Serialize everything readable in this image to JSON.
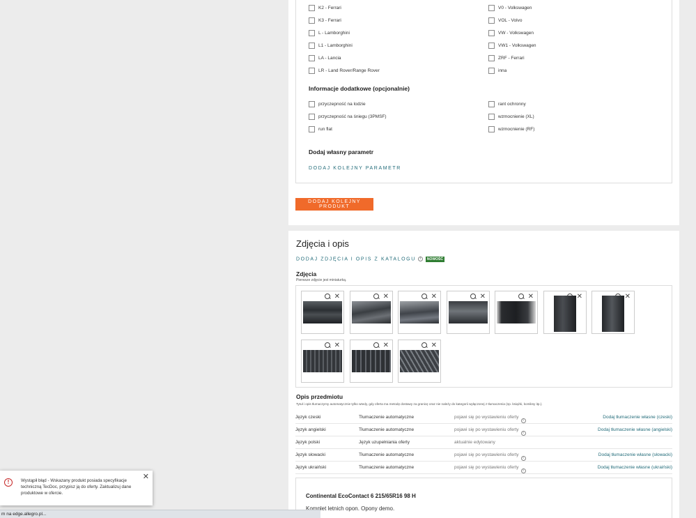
{
  "parameters": {
    "left_marks": [
      "K2 - Ferrari",
      "K3 - Ferrari",
      "L - Lamborghini",
      "L1 - Lamborghini",
      "LA - Lancia",
      "LR - Land Rover/Range Rover"
    ],
    "right_marks": [
      "V0 - Volkswagen",
      "VOL - Volvo",
      "VW - Volkswagen",
      "VW1 - Volkswagen",
      "ZRF - Ferrari",
      "inna"
    ],
    "additional_title": "Informacje dodatkowe (opcjonalnie)",
    "additional_left": [
      "przyczepność na lodzie",
      "przyczepność na śniegu (3PMSF)",
      "run flat"
    ],
    "additional_right": [
      "rant ochronny",
      "wzmocnienie (XL)",
      "wzmocnienie (RF)"
    ],
    "custom_title": "Dodaj własny parametr",
    "add_param_link": "DODAJ KOLEJNY PARAMETR",
    "add_product_button": "DODAJ KOLEJNY PRODUKT"
  },
  "photos_section": {
    "title": "Zdjęcia i opis",
    "catalog_link": "DODAJ ZDJĘCIA I OPIS Z KATALOGU",
    "new_badge": "NOWOŚĆ",
    "photos_label": "Zdjęcia",
    "photos_note": "Pierwsze zdjęcie jest miniaturką."
  },
  "description": {
    "title": "Opis przedmiotu",
    "note": "Tytuł i opis tłumaczymy automatycznie tylko wtedy, gdy oferta ma metodę dostawy za granicę oraz nie należy do kategorii wyłączonej z tłumaczenia (np. książki, komiksy itp.).",
    "languages": [
      {
        "lang": "Język czeski",
        "mode": "Tłumaczenie automatyczne",
        "status": "pojawi się po wystawieniu oferty",
        "action": "Dodaj tłumaczenie własne (czeski)"
      },
      {
        "lang": "Język angielski",
        "mode": "Tłumaczenie automatyczne",
        "status": "pojawi się po wystawieniu oferty",
        "action": "Dodaj tłumaczenie własne (angielski)"
      },
      {
        "lang": "Język polski",
        "mode": "Język uzupełniania oferty",
        "status": "aktualnie edytowany",
        "action": ""
      },
      {
        "lang": "Język słowacki",
        "mode": "Tłumaczenie automatyczne",
        "status": "pojawi się po wystawieniu oferty",
        "action": "Dodaj tłumaczenie własne (słowacki)"
      },
      {
        "lang": "Język ukraiński",
        "mode": "Tłumaczenie automatyczne",
        "status": "pojawi się po wystawieniu oferty",
        "action": "Dodaj tłumaczenie własne (ukraiński)"
      }
    ],
    "heading": "Continental EcoContact 6 215/65R16 98 H",
    "body": "Komplet letnich opon. Opony demo."
  },
  "toast": {
    "message": "Wystąpił błąd - Wskazany produkt posiada specyfikacje techniczną TecDoc, przypisz ją do oferty. Zaktualizuj dane produktowe w ofercie."
  },
  "status_bar": {
    "text": "m na edge.allegro.pl..."
  },
  "colors": {
    "accent_orange": "#f06a2a",
    "link_teal": "#236c7a",
    "badge_green": "#2f7d32",
    "error_red": "#c62828"
  }
}
